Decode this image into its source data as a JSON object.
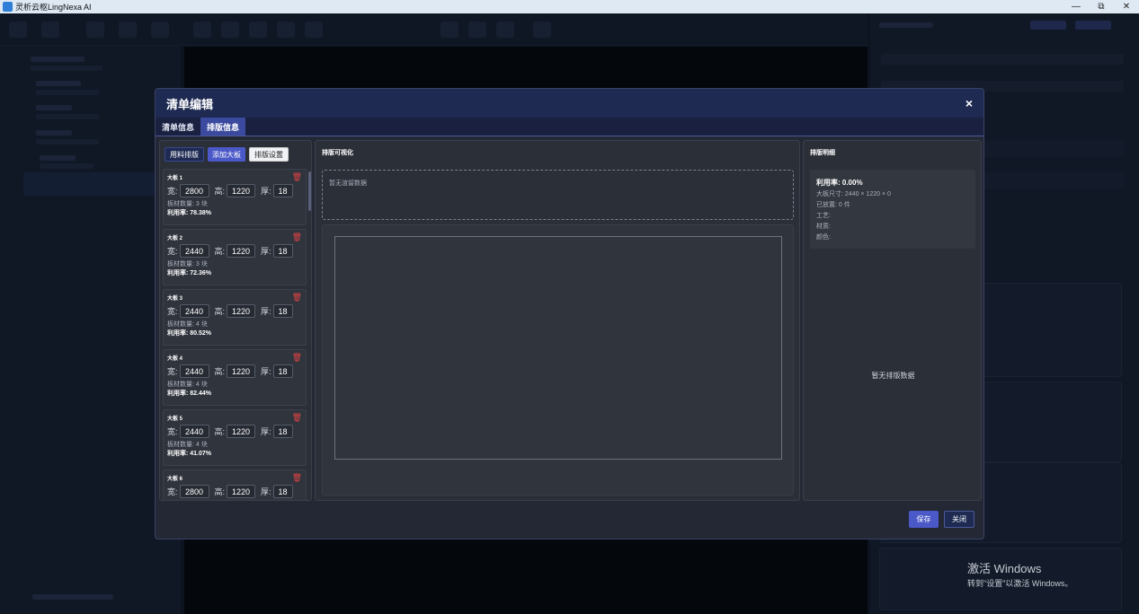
{
  "window": {
    "title": "灵析云枢LingNexa AI",
    "min": "—",
    "restore": "⧉",
    "close": "✕"
  },
  "modal": {
    "title": "清单编辑",
    "close": "×",
    "tabs": [
      {
        "label": "清单信息"
      },
      {
        "label": "排版信息"
      }
    ],
    "active_tab": 1,
    "buttons": {
      "use_material": "用料排版",
      "add_board": "添加大板",
      "settings": "排版设置"
    },
    "labels": {
      "w": "宽:",
      "h": "高:",
      "t": "厚:"
    },
    "boards": [
      {
        "name": "大板 1",
        "w": "2800",
        "h": "1220",
        "t": "18",
        "count": "板材数量: 3 块",
        "rate": "利用率: 78.38%"
      },
      {
        "name": "大板 2",
        "w": "2440",
        "h": "1220",
        "t": "18",
        "count": "板材数量: 3 块",
        "rate": "利用率: 72.36%"
      },
      {
        "name": "大板 3",
        "w": "2440",
        "h": "1220",
        "t": "18",
        "count": "板材数量: 4 块",
        "rate": "利用率: 80.52%"
      },
      {
        "name": "大板 4",
        "w": "2440",
        "h": "1220",
        "t": "18",
        "count": "板材数量: 4 块",
        "rate": "利用率: 82.44%"
      },
      {
        "name": "大板 5",
        "w": "2440",
        "h": "1220",
        "t": "18",
        "count": "板材数量: 4 块",
        "rate": "利用率: 41.07%"
      },
      {
        "name": "大板 6",
        "w": "2800",
        "h": "1220",
        "t": "18",
        "count": "",
        "rate": ""
      }
    ],
    "viz": {
      "title": "排版可视化",
      "empty": "暂无渲留数据"
    },
    "detail": {
      "title": "排版明细",
      "util": "利用率: 0.00%",
      "size": "大板尺寸: 2440 × 1220 × 0",
      "placed": "已放置: 0 件",
      "craft": "工艺:",
      "material": "材质:",
      "color": "颜色:",
      "empty": "暂无排版数据"
    },
    "footer": {
      "save": "保存",
      "close": "关闭"
    }
  },
  "activation": {
    "line1": "激活 Windows",
    "line2": "转到\"设置\"以激活 Windows。"
  }
}
